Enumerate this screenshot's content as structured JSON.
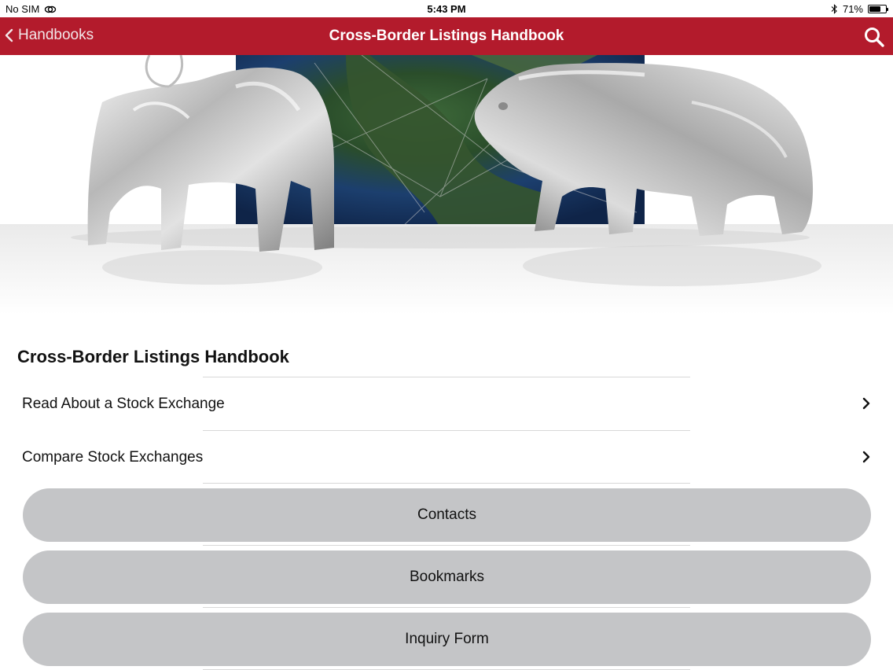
{
  "status_bar": {
    "carrier": "No SIM",
    "time": "5:43 PM",
    "battery_text": "71%",
    "battery_level": 0.71
  },
  "nav": {
    "back_label": "Handbooks",
    "title": "Cross-Border Listings Handbook"
  },
  "content": {
    "section_title": "Cross-Border Listings Handbook",
    "rows": [
      {
        "label": "Read About a Stock Exchange"
      },
      {
        "label": "Compare Stock Exchanges"
      }
    ],
    "buttons": [
      {
        "label": "Contacts"
      },
      {
        "label": "Bookmarks"
      },
      {
        "label": "Inquiry Form"
      }
    ]
  },
  "colors": {
    "nav_background": "#b31b2c",
    "pill_background": "#c4c5c7"
  }
}
